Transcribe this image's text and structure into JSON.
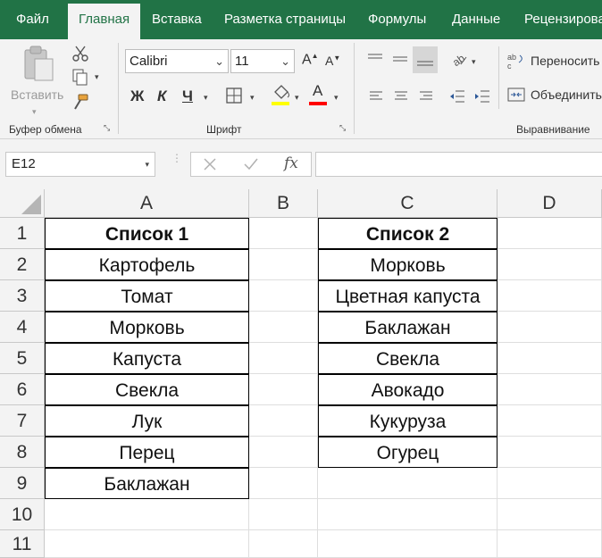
{
  "tabs": [
    "Файл",
    "Главная",
    "Вставка",
    "Разметка страницы",
    "Формулы",
    "Данные",
    "Рецензирова"
  ],
  "clipboard": {
    "paste_label": "Вставить",
    "group_label": "Буфер обмена"
  },
  "font": {
    "name": "Calibri",
    "size": "11",
    "group_label": "Шрифт",
    "bold": "Ж",
    "italic": "К",
    "underline": "Ч",
    "fill_color": "#ffff00",
    "font_color": "#ff0000",
    "font_color_letter": "A"
  },
  "alignment": {
    "wrap_label": "Переносить",
    "merge_label": "Объединить",
    "group_label": "Выравнивание"
  },
  "formula_bar": {
    "name_box": "E12",
    "fx": "fx",
    "value": ""
  },
  "columns": [
    "A",
    "B",
    "C",
    "D"
  ],
  "rows": [
    "1",
    "2",
    "3",
    "4",
    "5",
    "6",
    "7",
    "8",
    "9",
    "10",
    "11"
  ],
  "list1": [
    "Список 1",
    "Картофель",
    "Томат",
    "Морковь",
    "Капуста",
    "Свекла",
    "Лук",
    "Перец",
    "Баклажан"
  ],
  "list2": [
    "Список 2",
    "Морковь",
    "Цветная капуста",
    "Баклажан",
    "Свекла",
    "Авокадо",
    "Кукуруза",
    "Огурец"
  ],
  "colors": {
    "brand": "#217346",
    "ribbon": "#f3f3f3"
  }
}
